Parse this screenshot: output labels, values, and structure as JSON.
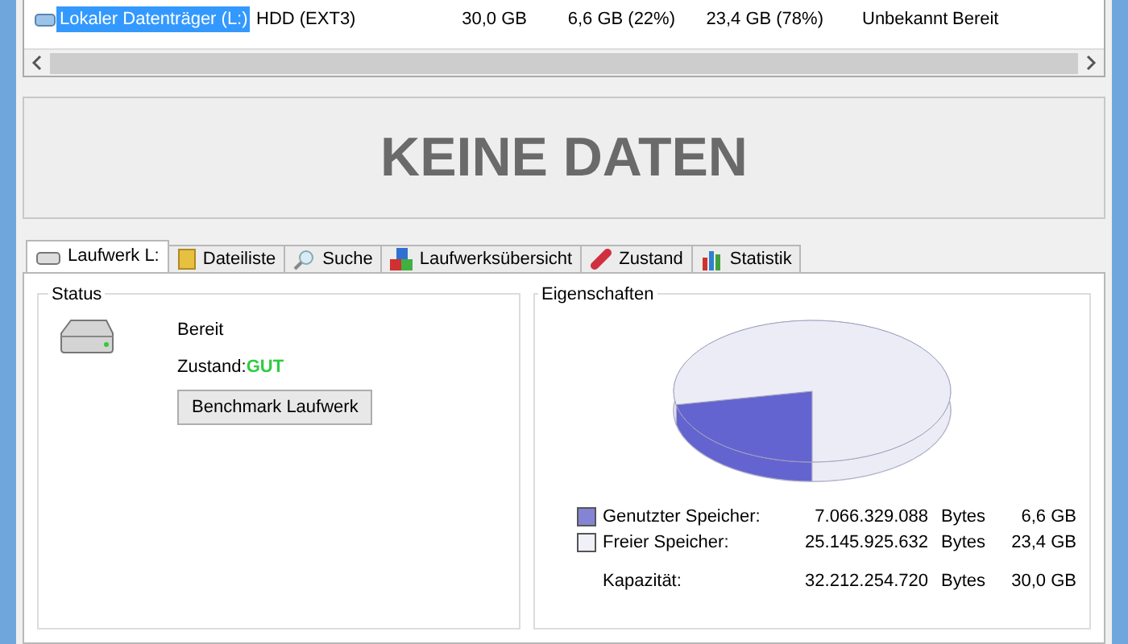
{
  "drive_list": {
    "rows": [
      {
        "name": "Lokaler Datenträger (L:)",
        "type": "HDD (EXT3)",
        "total": "30,0 GB",
        "used": "6,6 GB (22%)",
        "free": "23,4 GB (78%)",
        "health": "Unbekannt",
        "status": "Bereit",
        "selected": true
      }
    ]
  },
  "banner": {
    "text": "KEINE DATEN"
  },
  "tabs": [
    {
      "label": "Laufwerk L:",
      "kind": "drive",
      "selected": true
    },
    {
      "label": "Dateiliste",
      "kind": "folder",
      "selected": false
    },
    {
      "label": "Suche",
      "kind": "search",
      "selected": false
    },
    {
      "label": "Laufwerksübersicht",
      "kind": "blocks",
      "selected": false
    },
    {
      "label": "Zustand",
      "kind": "pill",
      "selected": false
    },
    {
      "label": "Statistik",
      "kind": "chart",
      "selected": false
    }
  ],
  "status_group": {
    "title": "Status",
    "state": "Bereit",
    "health_label": "Zustand:",
    "health_value": "GUT",
    "button": "Benchmark Laufwerk"
  },
  "properties_group": {
    "title": "Eigenschaften",
    "rows": [
      {
        "label": "Genutzter Speicher:",
        "bytes": "7.066.329.088",
        "unit": "Bytes",
        "size": "6,6 GB",
        "color": "#8484d4"
      },
      {
        "label": "Freier Speicher:",
        "bytes": "25.145.925.632",
        "unit": "Bytes",
        "size": "23,4 GB",
        "color": "#f0f0f8"
      },
      {
        "label": "Kapazität:",
        "bytes": "32.212.254.720",
        "unit": "Bytes",
        "size": "30,0 GB"
      }
    ]
  }
}
